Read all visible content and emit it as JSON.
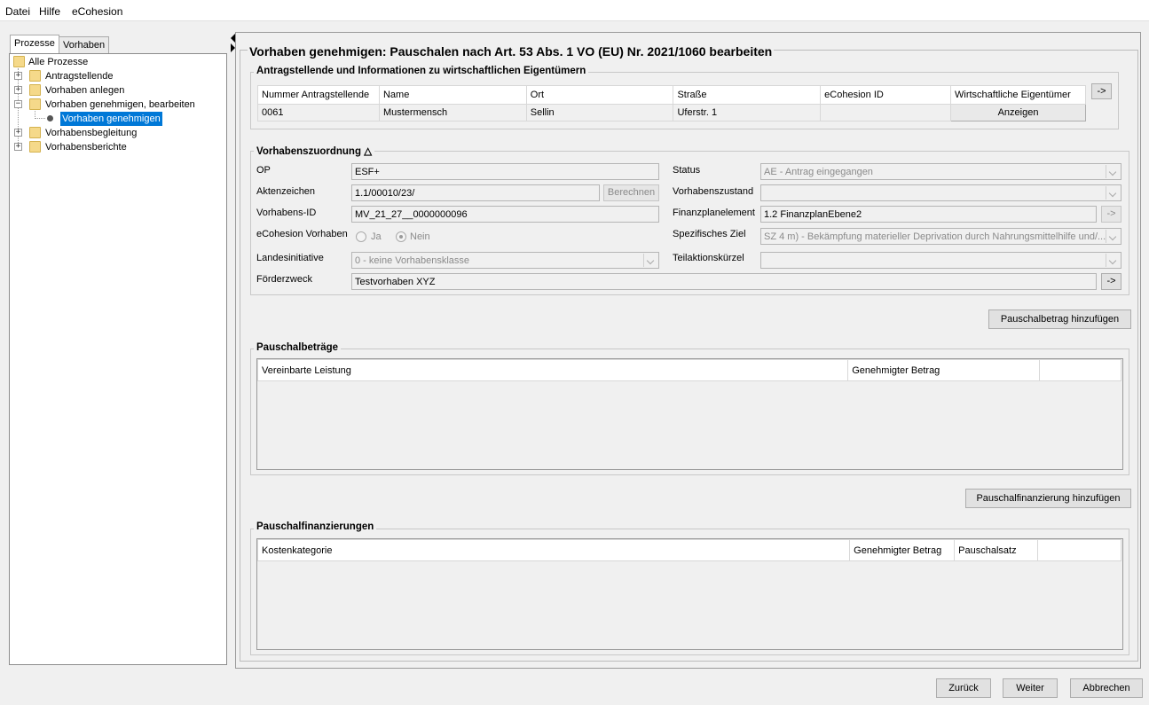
{
  "menu": [
    "Datei",
    "Hilfe",
    "eCohesion"
  ],
  "left_tabs": [
    "Prozesse",
    "Vorhaben"
  ],
  "tree": {
    "root": "Alle Prozesse",
    "items": [
      "Antragstellende",
      "Vorhaben anlegen",
      "Vorhaben genehmigen, bearbeiten",
      "Vorhabensbegleitung",
      "Vorhabensberichte"
    ],
    "selected_child": "Vorhaben genehmigen"
  },
  "title": "Vorhaben genehmigen: Pauschalen nach Art. 53 Abs. 1 VO (EU) Nr. 2021/1060 bearbeiten",
  "antrag": {
    "title": "Antragstellende und Informationen zu wirtschaftlichen Eigentümern",
    "headers": [
      "Nummer Antragstellende",
      "Name",
      "Ort",
      "Straße",
      "eCohesion ID",
      "Wirtschaftliche Eigentümer"
    ],
    "row": [
      "0061",
      "Mustermensch",
      "Sellin",
      "Uferstr. 1",
      "",
      "Anzeigen"
    ],
    "arrow_button": "->"
  },
  "zuordnung": {
    "title": "Vorhabenszuordnung",
    "collapse_glyph": "△",
    "op_label": "OP",
    "op_value": "ESF+",
    "aktenzeichen_label": "Aktenzeichen",
    "aktenzeichen_value": "1.1/00010/23/",
    "berechnen": "Berechnen",
    "vorhabens_id_label": "Vorhabens-ID",
    "vorhabens_id_value": "MV_21_27__0000000096",
    "ecohesion_label": "eCohesion Vorhaben",
    "ja": "Ja",
    "nein": "Nein",
    "ecohesion_selected": "Nein",
    "landesinitiative_label": "Landesinitiative",
    "landesinitiative_value": "0 - keine Vorhabensklasse",
    "foerderzweck_label": "Förderzweck",
    "foerderzweck_value": "Testvorhaben XYZ",
    "status_label": "Status",
    "status_value": "AE - Antrag eingegangen",
    "zustand_label": "Vorhabenszustand",
    "zustand_value": "",
    "finanzplan_label": "Finanzplanelement",
    "finanzplan_value": "1.2 FinanzplanEbene2",
    "ziel_label": "Spezifisches Ziel",
    "ziel_value": "SZ 4 m) - Bekämpfung materieller Deprivation durch Nahrungsmittelhilfe und/...",
    "teilaktion_label": "Teilaktionskürzel",
    "teilaktion_value": "",
    "arrow_button": "->"
  },
  "pauschal": {
    "add_button": "Pauschalbetrag hinzufügen",
    "title": "Pauschalbeträge",
    "headers": [
      "Vereinbarte Leistung",
      "Genehmigter Betrag",
      ""
    ]
  },
  "finanz": {
    "add_button": "Pauschalfinanzierung hinzufügen",
    "title": "Pauschalfinanzierungen",
    "headers": [
      "Kostenkategorie",
      "Genehmigter Betrag",
      "Pauschalsatz",
      ""
    ]
  },
  "footer": {
    "back": "Zurück",
    "next": "Weiter",
    "cancel": "Abbrechen"
  },
  "colors": {
    "selection": "#0078d7",
    "folder": "#f5d98a"
  }
}
